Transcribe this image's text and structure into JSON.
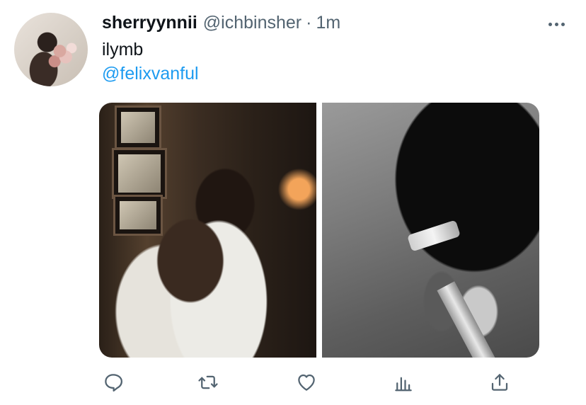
{
  "tweet": {
    "display_name": "sherryynnii",
    "handle": "@ichbinsher",
    "separator": "·",
    "time": "1m",
    "text": "ilymb",
    "mention": "@felixvanful"
  },
  "icons": {
    "more": "more-horizontal-icon",
    "reply": "reply-icon",
    "retweet": "retweet-icon",
    "like": "heart-icon",
    "analytics": "analytics-icon",
    "share": "share-icon"
  },
  "colors": {
    "text": "#0f1419",
    "secondary": "#536471",
    "link": "#1d9bf0",
    "background": "#ffffff"
  }
}
